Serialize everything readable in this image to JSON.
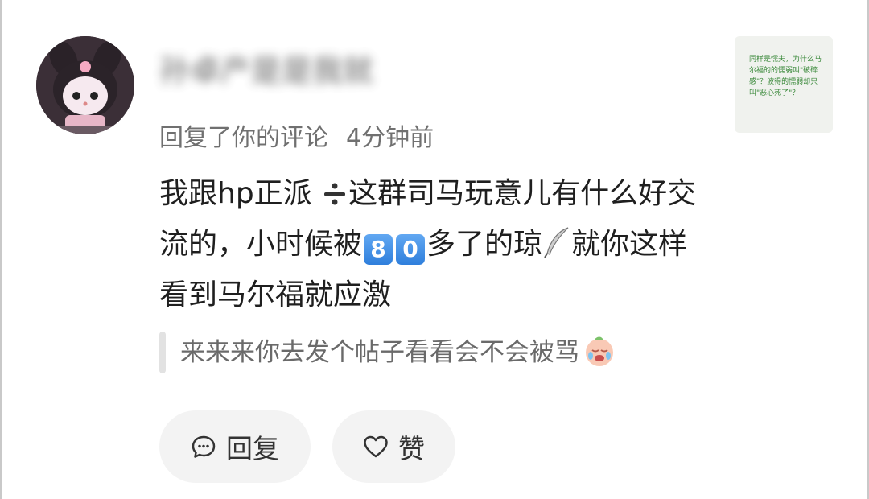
{
  "comment": {
    "username": "孙卓产是是我就",
    "action": "回复了你的评论",
    "time": "4分钟前",
    "body": {
      "line1_a": "我跟hp正派",
      "line1_b": "这群司马玩意儿有什",
      "line2_a": "么好交流的，小时候被",
      "num1": "8",
      "num2": "0",
      "line2_b": "多了的",
      "line3_a": "琼",
      "line3_b": "就你这样看到马尔福就应激"
    },
    "quote": "来来来你去发个帖子看看会不会被骂"
  },
  "actions": {
    "reply_label": "回复",
    "like_label": "赞"
  },
  "thumbnail_note": {
    "text": "同样是懦夫，为什么马尔福的的懦弱叫\"破碎感\"？波得的懦弱却只叫\"恶心死了\"？"
  },
  "icons": {
    "divide": "divide-icon",
    "feather": "feather-pen-icon",
    "crying_emoji": "crying-face-icon",
    "comment": "comment-bubble-icon",
    "heart": "heart-outline-icon"
  },
  "colors": {
    "accent_blue": "#2f7fdc",
    "button_bg": "#f3f3f3",
    "note_green": "#3c8a3c"
  }
}
